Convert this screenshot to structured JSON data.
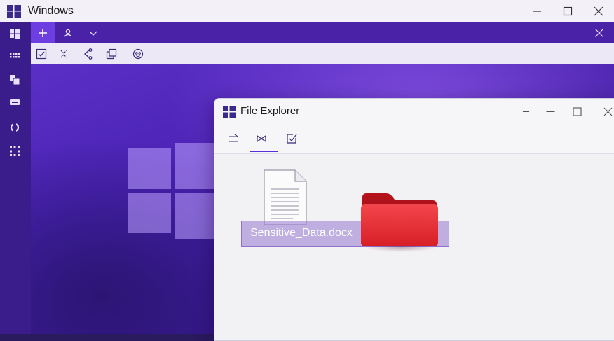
{
  "window": {
    "title": "Windows",
    "controls": [
      "minimize-icon",
      "maximize-icon",
      "close-icon"
    ]
  },
  "sidebar": {
    "items": [
      {
        "icon": "windows-icon"
      },
      {
        "icon": "apps-grid-icon"
      },
      {
        "icon": "copy-icon"
      },
      {
        "icon": "keyboard-icon"
      },
      {
        "icon": "sync-icon"
      },
      {
        "icon": "dots-grid-icon"
      }
    ]
  },
  "tabbar": {
    "items": [
      "move-icon",
      "user-icon",
      "chevron-down-icon"
    ],
    "close": "close-icon"
  },
  "toolbar": {
    "items": [
      "checkbox-icon",
      "dashed-arrows-icon",
      "share-icon",
      "duplicate-icon",
      "emoji-icon"
    ]
  },
  "explorer": {
    "title": "File Explorer",
    "tools": [
      "list-icon",
      "bowtie-icon",
      "edit-checkbox-icon"
    ],
    "file": {
      "name": "Sensitive_Data.docx",
      "icon": "document-icon",
      "selected": true
    },
    "folder": {
      "icon": "folder-icon",
      "color": "#e0242c"
    }
  },
  "colors": {
    "accent": "#5b2fd6",
    "sidebar": "#3a1d8a",
    "tabbar": "#4a22a8",
    "folder": "#e0242c"
  }
}
